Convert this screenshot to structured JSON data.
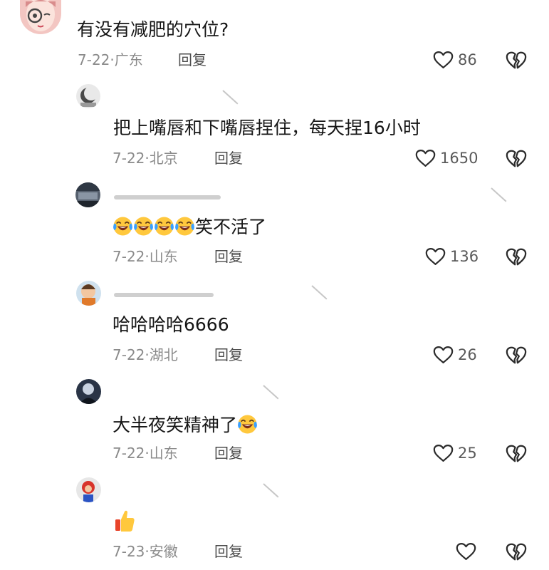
{
  "colors": {
    "text": "#161616",
    "meta": "#8a8a8a",
    "icon": "#2b2b2b",
    "background": "#ffffff"
  },
  "icons": {
    "like": "heart-outline-icon",
    "dislike": "broken-heart-icon",
    "laugh": "laughing-crying-emoji-icon",
    "thumbs": "thumbs-up-emoji-icon"
  },
  "comments": [
    {
      "text": "有没有减肥的穴位?",
      "date": "7-22",
      "location": "广东",
      "reply": "回复",
      "likes": "86"
    },
    {
      "text": "把上嘴唇和下嘴唇捏住，每天捏16小时",
      "date": "7-22",
      "location": "北京",
      "reply": "回复",
      "likes": "1650"
    },
    {
      "text": "笑不活了",
      "date": "7-22",
      "location": "山东",
      "reply": "回复",
      "likes": "136"
    },
    {
      "text": "哈哈哈哈6666",
      "date": "7-22",
      "location": "湖北",
      "reply": "回复",
      "likes": "26"
    },
    {
      "text": "大半夜笑精神了",
      "date": "7-22",
      "location": "山东",
      "reply": "回复",
      "likes": "25"
    },
    {
      "text": "",
      "date": "7-23",
      "location": "安徽",
      "reply": "回复",
      "likes": ""
    }
  ]
}
